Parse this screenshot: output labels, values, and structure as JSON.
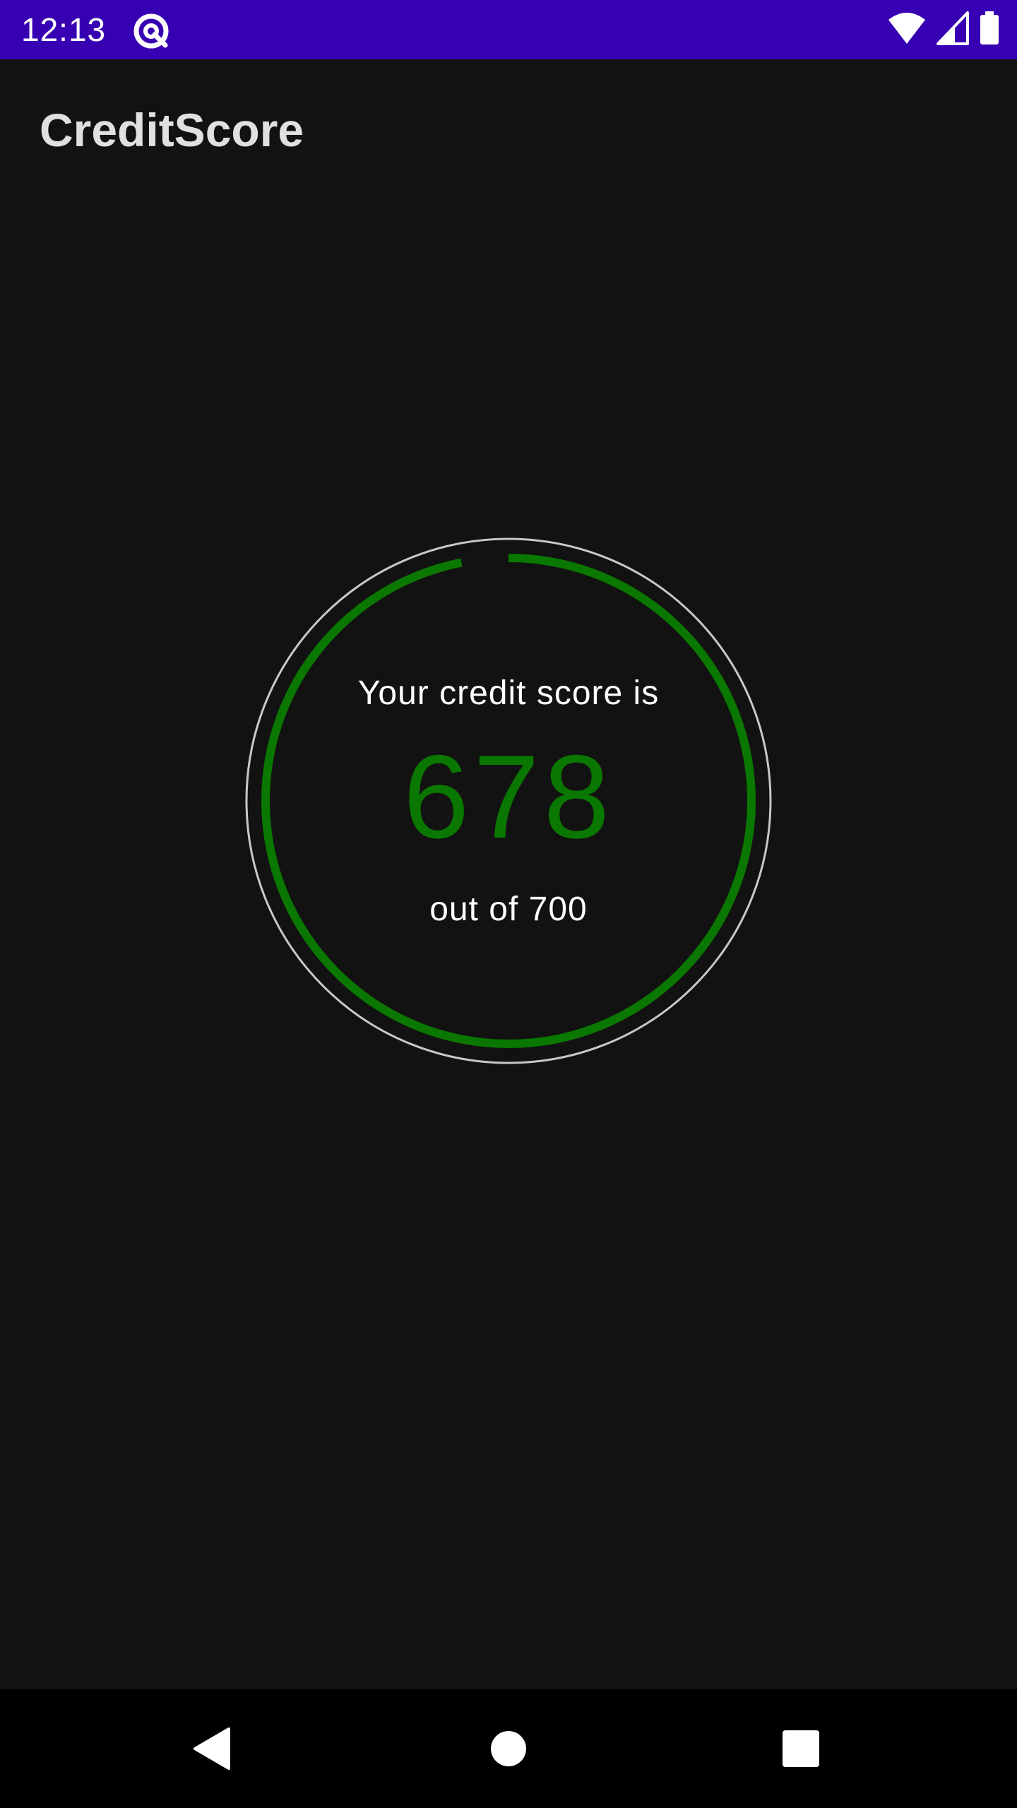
{
  "status_bar": {
    "time": "12:13",
    "background": "#3700B3",
    "icons": [
      "app-notification-icon",
      "wifi-icon",
      "cell-signal-icon",
      "battery-icon"
    ]
  },
  "app_bar": {
    "title": "CreditScore"
  },
  "score": {
    "label": "Your credit score is",
    "value": "678",
    "max_text": "out of 700",
    "progress_fraction": 0.969,
    "accent_color": "#0A7700",
    "outline_color": "#C8C8C8"
  },
  "nav_bar": {
    "buttons": [
      "back-icon",
      "home-icon",
      "recents-icon"
    ]
  }
}
